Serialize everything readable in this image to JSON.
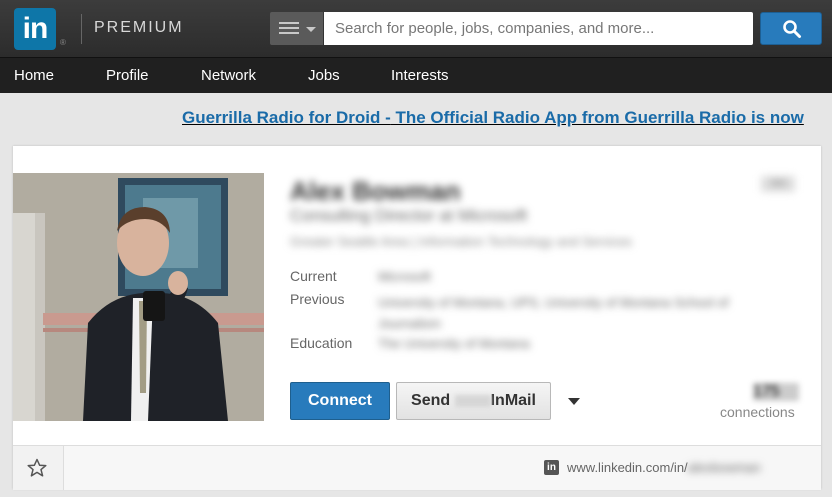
{
  "header": {
    "logo_text": "in",
    "logo_reg": "®",
    "premium_label": "PREMIUM",
    "search": {
      "placeholder": "Search for people, jobs, companies, and more..."
    }
  },
  "nav": {
    "items": [
      {
        "label": "Home"
      },
      {
        "label": "Profile"
      },
      {
        "label": "Network"
      },
      {
        "label": "Jobs"
      },
      {
        "label": "Interests"
      }
    ]
  },
  "ad": {
    "title": "Guerrilla Radio for Droid -",
    "text": " The Official Radio App from Guerrilla Radio is now"
  },
  "profile": {
    "name": "Alex Bowman",
    "headline": "Consulting Director at Microsoft",
    "location": "Greater Seattle Area | Information Technology and Services",
    "degree": "3rd",
    "labels": {
      "current": "Current",
      "previous": "Previous",
      "education": "Education"
    },
    "current": "Microsoft",
    "previous": "University of Montana, UPS, University of Montana School of Journalism",
    "education": "The University of Montana",
    "connect_label": "Connect",
    "inmail_prefix": "Send ",
    "inmail_suffix": "InMail",
    "connections_count": "175",
    "connections_label": "connections",
    "url_prefix": "www.linkedin.com/in/",
    "url_slug": "alexbowman"
  },
  "colors": {
    "brand": "#0e76a8",
    "button_blue": "#287bbc",
    "link": "#1a6ba8"
  }
}
